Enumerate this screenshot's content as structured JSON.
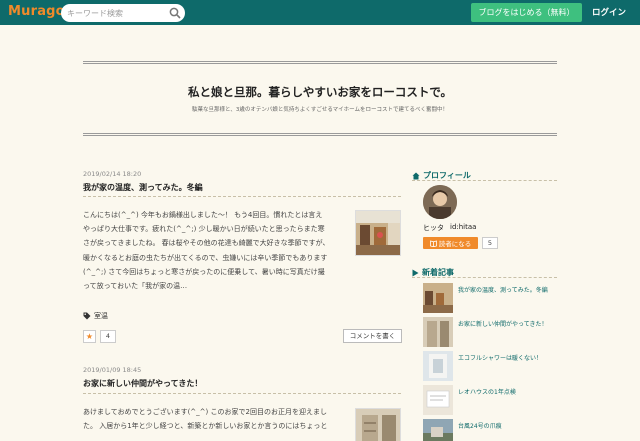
{
  "topbar": {
    "logo": "Muragon",
    "search_placeholder": "キーワード検索",
    "start_blog": "ブログをはじめる（無料）",
    "login": "ログイン"
  },
  "blog": {
    "title": "私と娘と旦那。暮らしやすいお家をローコストで。",
    "description": "駄菓な旦那様と、3歳のオテンバ娘と気持ちよくすごせるマイホームをローコストで建てるべく奮闘中！"
  },
  "articles": [
    {
      "date": "2019/02/14 18:20",
      "title": "我が家の温度、測ってみた。冬編",
      "body_lines": [
        "こんにちは(^_^) 今年もお鍋様出しました〜！ もう4回目。慣れたとは言え",
        "やっぱり大仕事です。疲れた(^_^;) 少し暖かい日が続いたと思ったらまた寒",
        "さが戻ってきましたね。 春は桜やその他の花達も綺麗で大好きな季節ですが、",
        "暖かくなるとお庭の虫たちが出てくるので、虫嫌いには辛い季節でもあります",
        "(^_^;) さて今回はちょっと寒さが戻ったのに便乗して、暑い時に写真だけ撮",
        "って放っておいた「我が家の温…"
      ],
      "category": "室温",
      "star_count": "4",
      "comment_button": "コメントを書く"
    },
    {
      "date": "2019/01/09 18:45",
      "title": "お家に新しい仲間がやってきた！",
      "body_lines": [
        "あけましておめでとうございます(^_^) このお家で2回目のお正月を迎えまし",
        "た。 入居から1年と少し経つと、新築とか新しいお家とか言うのにはちょっと"
      ]
    }
  ],
  "sidebar": {
    "profile_heading": "プロフィール",
    "profile_name": "ヒッタ",
    "profile_id": "id:hitaa",
    "reader_button": "読者になる",
    "reader_count": "5",
    "recent_heading": "新着記事",
    "recent_posts": [
      "我が家の温度、測ってみた。冬編",
      "お家に新しい仲間がやってきた！",
      "エコフルシャワーは暖くない！",
      "レオハウスの1年点検",
      "台風24号の爪痕"
    ]
  },
  "colors": {
    "topbar": "#0e6a6a",
    "accent": "#f08a2a",
    "cta": "#3ec07f",
    "background": "#fbf8ee"
  }
}
